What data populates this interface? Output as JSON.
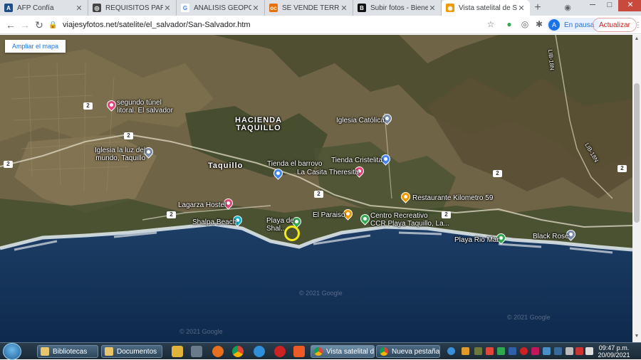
{
  "browser": {
    "tabs": [
      {
        "title": "AFP Confía",
        "favicon_color": "#1c4e8a",
        "favicon_text": "A"
      },
      {
        "title": "REQUISITOS PARA INICIAR",
        "favicon_color": "#444444",
        "favicon_text": "◎"
      },
      {
        "title": "ANALISIS GEOPOLITICO",
        "favicon_color": "#4285f4",
        "favicon_text": "G"
      },
      {
        "title": "SE VENDE TERRENO OPORT",
        "favicon_color": "#e8710a",
        "favicon_text": "oc"
      },
      {
        "title": "Subir fotos - BienesOnline",
        "favicon_color": "#111111",
        "favicon_text": "B"
      },
      {
        "title": "Vista satelital de San Salvador",
        "favicon_color": "#f29900",
        "favicon_text": "◉",
        "active": true
      }
    ],
    "url": "viajesyfotos.net/satelite/el_salvador/San-Salvador.htm",
    "profile_initial": "A",
    "profile_label": "En pausa",
    "update_label": "Actualizar"
  },
  "map": {
    "expand_button": "Ampliar el mapa",
    "copyright": "© 2021 Google",
    "area_labels": [
      {
        "text": "HACIENDA\nTAQUILLO",
        "big": true
      },
      {
        "text": "Taquillo",
        "big": true
      }
    ],
    "places": [
      {
        "name": "segundo túnel\nlitoral. El salvador",
        "color": "#e8447a"
      },
      {
        "name": "Iglesia Católica",
        "color": "#7a8ca8"
      },
      {
        "name": "Iglesia la luz del\nmundo, Taquillo",
        "color": "#7a8ca8"
      },
      {
        "name": "Tienda el barrovo",
        "color": "#4285f4"
      },
      {
        "name": "Tienda Cristelita",
        "color": "#4285f4"
      },
      {
        "name": "La Casita Theresita",
        "color": "#e8447a"
      },
      {
        "name": "Restaurante Kilometro 59",
        "color": "#f29900"
      },
      {
        "name": "Lagarza Hostel",
        "color": "#e8447a"
      },
      {
        "name": "El Paraiso",
        "color": "#f29900"
      },
      {
        "name": "Centro Recreativo\nCCR Playa Taquillo, La...",
        "color": "#34a853"
      },
      {
        "name": "Shalpa Beach",
        "color": "#12b5cb"
      },
      {
        "name": "Playa de\nShal...",
        "color": "#34a853"
      },
      {
        "name": "Playa Rio Mar",
        "color": "#34a853"
      },
      {
        "name": "Black Rose",
        "color": "#7a8ca8"
      }
    ],
    "roads": [
      "2",
      "2",
      "2",
      "2",
      "2",
      "2",
      "2",
      "2"
    ],
    "road_names": [
      "LIB-18N",
      "LIB-18N"
    ]
  },
  "taskbar": {
    "buttons": [
      "Bibliotecas",
      "Documentos",
      "Vista satelital de ...",
      "Nueva pestaña - ..."
    ],
    "time": "09:47 p.m.",
    "date": "20/09/2021"
  }
}
